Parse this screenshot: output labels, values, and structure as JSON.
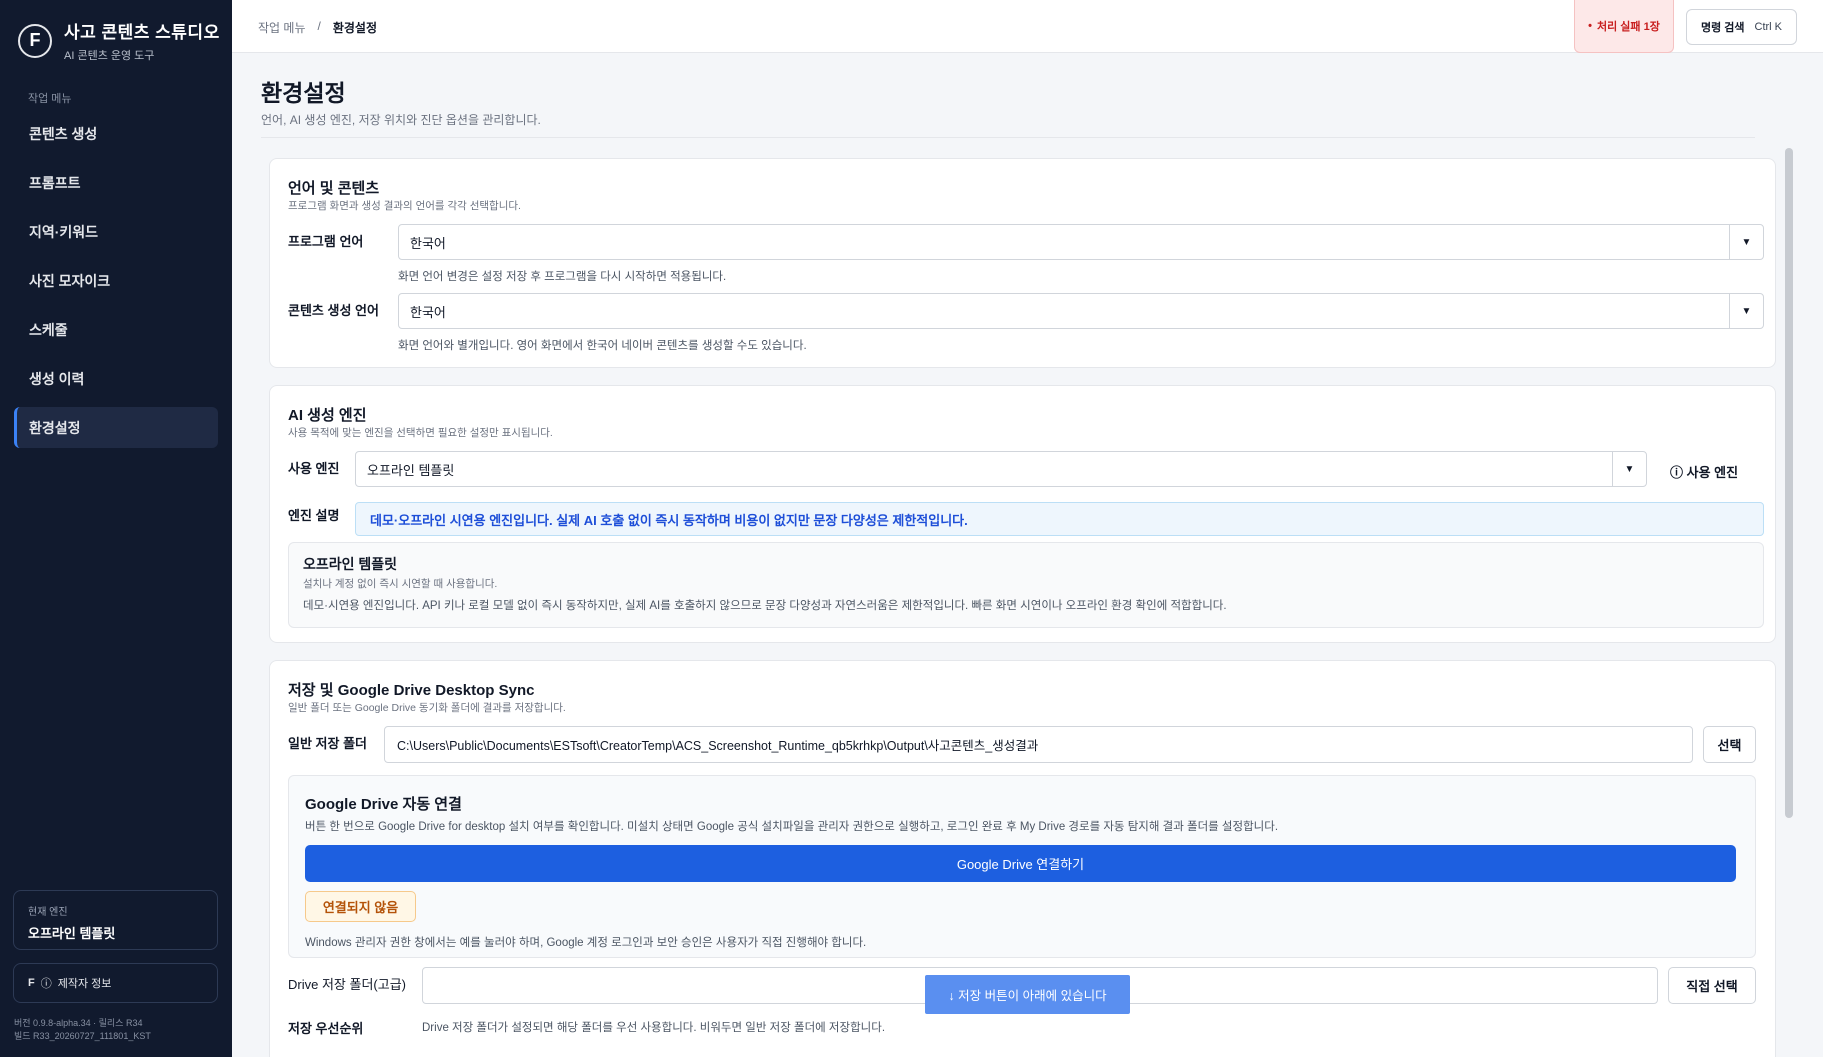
{
  "sidebar": {
    "brand_logo": "F",
    "brand_title": "사고 콘텐츠 스튜디오",
    "brand_subtitle": "AI 콘텐츠 운영 도구",
    "nav_label": "작업 메뉴",
    "items": [
      {
        "label": "콘텐츠 생성"
      },
      {
        "label": "프롬프트"
      },
      {
        "label": "지역·키워드"
      },
      {
        "label": "사진 모자이크"
      },
      {
        "label": "스케줄"
      },
      {
        "label": "생성 이력"
      },
      {
        "label": "환경설정"
      }
    ],
    "current_engine_label": "현재 엔진",
    "current_engine_value": "오프라인 템플릿",
    "maker_info_label": "제작자 정보",
    "version_line1": "버전 0.9.8-alpha.34 · 릴리스 R34",
    "version_line2": "빌드 R33_20260727_111801_KST"
  },
  "topbar": {
    "breadcrumb_root": "작업 메뉴",
    "breadcrumb_sep": "/",
    "breadcrumb_current": "환경설정",
    "fail_badge_dot": "•",
    "fail_badge": "처리 실패 1장",
    "command_search": "명령 검색",
    "command_shortcut": "Ctrl K"
  },
  "page": {
    "title": "환경설정",
    "subtitle": "언어, AI 생성 엔진, 저장 위치와 진단 옵션을 관리합니다."
  },
  "language": {
    "title": "언어 및 콘텐츠",
    "desc": "프로그램 화면과 생성 결과의 언어를 각각 선택합니다.",
    "program_language_label": "프로그램 언어",
    "program_language_value": "한국어",
    "program_language_hint": "화면 언어 변경은 설정 저장 후 프로그램을 다시 시작하면 적용됩니다.",
    "content_language_label": "콘텐츠 생성 언어",
    "content_language_value": "한국어",
    "content_language_hint": "화면 언어와 별개입니다. 영어 화면에서 한국어 네이버 콘텐츠를 생성할 수도 있습니다."
  },
  "engine": {
    "title": "AI 생성 엔진",
    "desc": "사용 목적에 맞는 엔진을 선택하면 필요한 설정만 표시됩니다.",
    "engine_label": "사용 엔진",
    "engine_value": "오프라인 템플릿",
    "info_button": "ⓘ 사용 엔진",
    "engine_desc_label": "엔진 설명",
    "engine_desc_value": "데모·오프라인 시연용 엔진입니다. 실제 AI 호출 없이 즉시 동작하며 비용이 없지만 문장 다양성은 제한적입니다.",
    "detail_title": "오프라인 템플릿",
    "detail_sub": "설치나 계정 없이 즉시 시연할 때 사용합니다.",
    "detail_body": "데모·시연용 엔진입니다. API 키나 로컬 모델 없이 즉시 동작하지만, 실제 AI를 호출하지 않으므로 문장 다양성과 자연스러움은 제한적입니다. 빠른 화면 시연이나 오프라인 환경 확인에 적합합니다."
  },
  "storage": {
    "title": "저장 및 Google Drive Desktop Sync",
    "desc": "일반 폴더 또는 Google Drive 동기화 폴더에 결과를 저장합니다.",
    "folder_label": "일반 저장 폴더",
    "folder_value": "C:\\Users\\Public\\Documents\\ESTsoft\\CreatorTemp\\ACS_Screenshot_Runtime_qb5krhkp\\Output\\사고콘텐츠_생성결과",
    "select_button": "선택",
    "gd_title": "Google Drive 자동 연결",
    "gd_desc": "버튼 한 번으로 Google Drive for desktop 설치 여부를 확인합니다. 미설치 상태면 Google 공식 설치파일을 관리자 권한으로 실행하고, 로그인 완료 후 My Drive 경로를 자동 탐지해 결과 폴더를 설정합니다.",
    "gd_button": "Google Drive 연결하기",
    "gd_status": "연결되지 않음",
    "gd_note": "Windows 관리자 권한 창에서는 예를 눌러야 하며, Google 계정 로그인과 보안 승인은 사용자가 직접 진행해야 합니다.",
    "drive_folder_label": "Drive 저장 폴더(고급)",
    "drive_folder_value": "",
    "direct_select_button": "직접 선택",
    "priority_label": "저장 우선순위",
    "priority_hint": "Drive 저장 폴더가 설정되면 해당 폴더를 우선 사용합니다. 비워두면 일반 저장 폴더에 저장합니다."
  },
  "scroll_hint": "↓ 저장 버튼이 아래에 있습니다",
  "colors": {
    "sidebar_bg": "#111a2e",
    "accent": "#1d5fe0",
    "fail": "#c81e1e"
  }
}
